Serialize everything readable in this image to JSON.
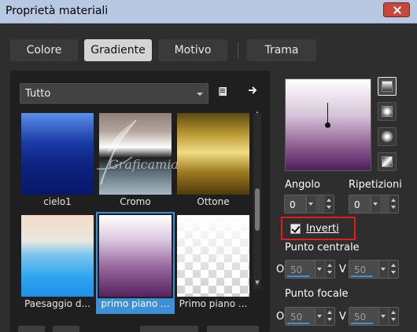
{
  "window": {
    "title": "Proprietà materiali"
  },
  "tabs": [
    {
      "label": "Colore"
    },
    {
      "label": "Gradiente"
    },
    {
      "label": "Motivo"
    },
    {
      "label": "Trama"
    }
  ],
  "active_tab": "Gradiente",
  "category": {
    "selected": "Tutto"
  },
  "gradients": [
    {
      "label": "cielo1"
    },
    {
      "label": "Cromo"
    },
    {
      "label": "Ottone"
    },
    {
      "label": "Paesaggio d..."
    },
    {
      "label": "primo piano ...",
      "selected": true
    },
    {
      "label": "Primo piano ..."
    }
  ],
  "watermark": {
    "text": "Graficamia"
  },
  "controls": {
    "angolo": {
      "label": "Angolo",
      "value": "0"
    },
    "ripetizioni": {
      "label": "Ripetizioni",
      "value": "0"
    },
    "inverti": {
      "label": "Inverti",
      "checked": true
    },
    "punto_centrale": {
      "label": "Punto centrale",
      "o_label": "O",
      "o_value": "50",
      "v_label": "V",
      "v_value": "50"
    },
    "punto_focale": {
      "label": "Punto focale",
      "o_label": "O",
      "o_value": "50",
      "v_label": "V",
      "v_value": "50"
    }
  },
  "icons": {
    "close": "close-icon",
    "library": "book-icon",
    "next": "arrow-right-icon",
    "dropdown": "chevron-down-icon"
  },
  "colors": {
    "accent": "#3d8fd8",
    "highlight_box": "#e01e1e",
    "gradient_preview_top": "#ffffff",
    "gradient_preview_bottom": "#4f1f5c"
  }
}
